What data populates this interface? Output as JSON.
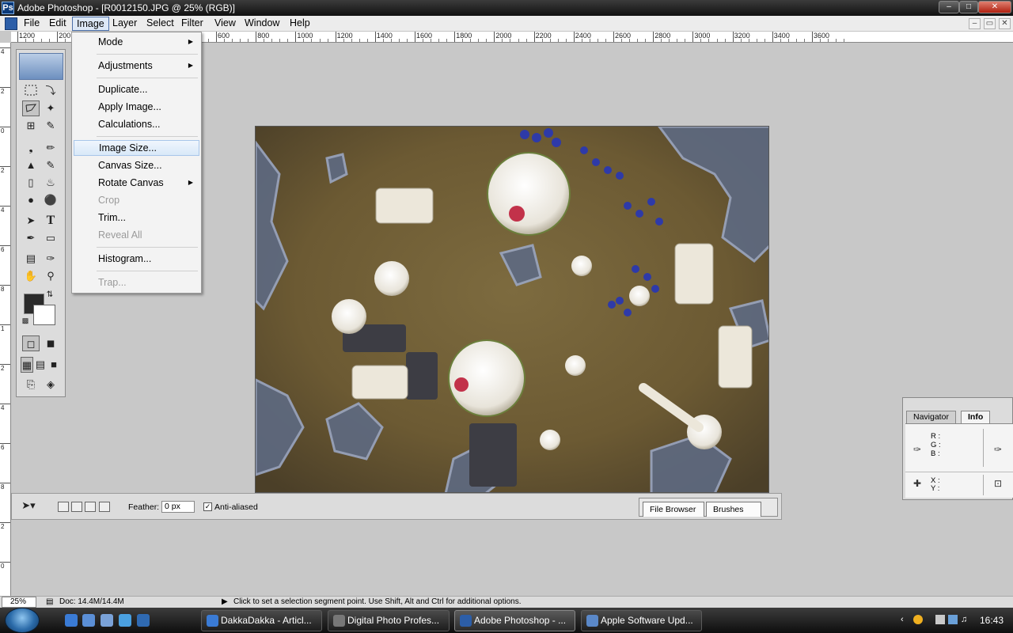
{
  "window": {
    "title": "Adobe Photoshop - [R0012150.JPG @ 25% (RGB)]",
    "app_icon": "photoshop-icon"
  },
  "menubar": {
    "items": [
      "File",
      "Edit",
      "Image",
      "Layer",
      "Select",
      "Filter",
      "View",
      "Window",
      "Help"
    ],
    "active": "Image"
  },
  "image_menu": {
    "items": [
      {
        "label": "Mode",
        "submenu": true,
        "enabled": true
      },
      {
        "label": "Adjustments",
        "submenu": true,
        "enabled": true
      },
      {
        "label": "Duplicate...",
        "enabled": true
      },
      {
        "label": "Apply Image...",
        "enabled": true
      },
      {
        "label": "Calculations...",
        "enabled": true
      },
      {
        "label": "Image Size...",
        "enabled": true,
        "highlighted": true
      },
      {
        "label": "Canvas Size...",
        "enabled": true
      },
      {
        "label": "Rotate Canvas",
        "submenu": true,
        "enabled": true
      },
      {
        "label": "Crop",
        "enabled": false
      },
      {
        "label": "Trim...",
        "enabled": true
      },
      {
        "label": "Reveal All",
        "enabled": false
      },
      {
        "label": "Histogram...",
        "enabled": true
      },
      {
        "label": "Trap...",
        "enabled": false
      }
    ]
  },
  "ruler": {
    "h_labels": [
      "1200",
      "200",
      "0",
      "200",
      "400",
      "600",
      "800",
      "1000",
      "1200",
      "1400",
      "1600",
      "1800",
      "2000",
      "2200",
      "2400",
      "2600",
      "2800",
      "3000",
      "3200",
      "3400",
      "3600"
    ],
    "v_labels": [
      "4",
      "2",
      "0",
      "2",
      "4",
      "6",
      "8",
      "1",
      "2",
      "4",
      "6",
      "8",
      "2",
      "0",
      "2"
    ]
  },
  "options_bar": {
    "feather_label": "Feather:",
    "feather_value": "0 px",
    "anti_aliased_label": "Anti-aliased",
    "anti_aliased_checked": true,
    "well_tabs": [
      "File Browser",
      "Brushes"
    ]
  },
  "info_palette": {
    "tabs": [
      "Navigator",
      "Info"
    ],
    "active_tab": "Info",
    "labels": [
      "R :",
      "G :",
      "B :",
      "X :",
      "Y :"
    ]
  },
  "statusbar": {
    "zoom": "25%",
    "doc": "Doc: 14.4M/14.4M",
    "hint": "Click to set a selection segment point.  Use Shift, Alt and Ctrl for additional options."
  },
  "taskbar": {
    "tasks": [
      {
        "label": "DakkaDakka - Articl...",
        "icon": "ie-icon",
        "active": false
      },
      {
        "label": "Digital Photo Profes...",
        "icon": "camera-icon",
        "active": false
      },
      {
        "label": "Adobe Photoshop - ...",
        "icon": "photoshop-icon",
        "active": true
      },
      {
        "label": "Apple Software Upd...",
        "icon": "apple-update-icon",
        "active": false
      }
    ],
    "clock": "16:43"
  },
  "colors": {
    "title_bar": "#1a1a1a",
    "menu_highlight": "#d8e8f8",
    "foreground_swatch": "#2b2b2b",
    "background_swatch": "#ffffff"
  }
}
